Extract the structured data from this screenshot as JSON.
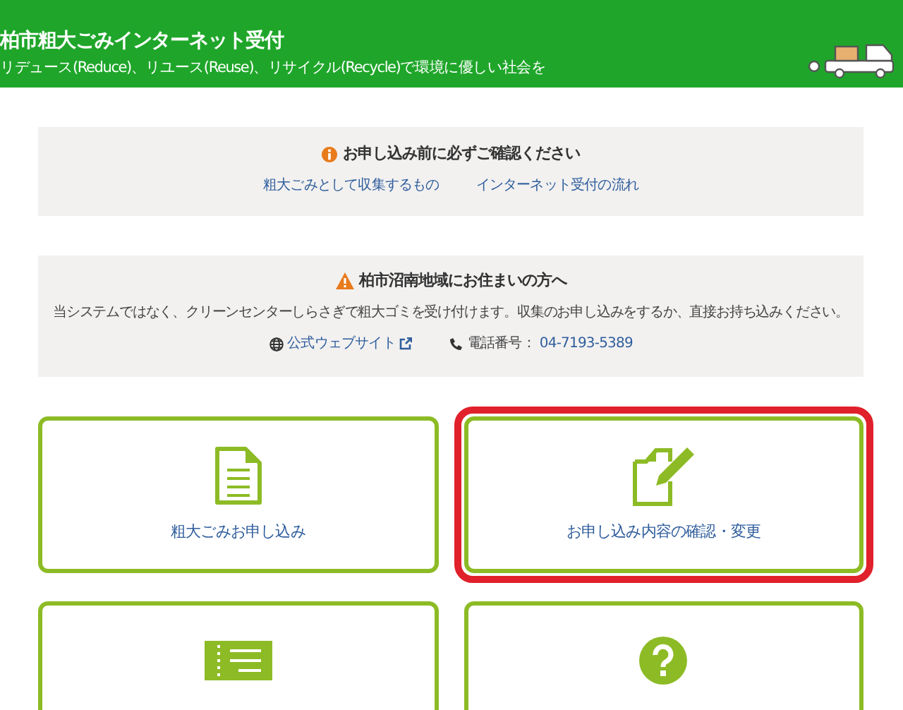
{
  "header": {
    "title": "柏市粗大ごみインターネット受付",
    "subtitle": "リデュース(Reduce)、リユース(Reuse)、リサイクル(Recycle)で環境に優しい社会を"
  },
  "notices": [
    {
      "kind": "info",
      "heading": "お申し込み前に必ずご確認ください",
      "links": [
        {
          "kind": "link",
          "label": "粗大ごみとして収集するもの"
        },
        {
          "kind": "link",
          "label": "インターネット受付の流れ"
        }
      ]
    },
    {
      "kind": "warning",
      "heading": "柏市沼南地域にお住まいの方へ",
      "text": "当システムではなく、クリーンセンターしらさぎで粗大ゴミを受け付けます。収集のお申し込みをするか、直接お持ち込みください。",
      "links": [
        {
          "kind": "website",
          "label": "公式ウェブサイト"
        },
        {
          "kind": "phone",
          "label": "電話番号：",
          "value": "04-7193-5389"
        }
      ]
    }
  ],
  "cards": [
    {
      "kind": "document",
      "label": "粗大ごみお申し込み",
      "highlighted": false
    },
    {
      "kind": "edit",
      "label": "お申し込み内容の確認・変更",
      "highlighted": true
    },
    {
      "kind": "ticket",
      "highlighted": false
    },
    {
      "kind": "help",
      "highlighted": false
    }
  ]
}
